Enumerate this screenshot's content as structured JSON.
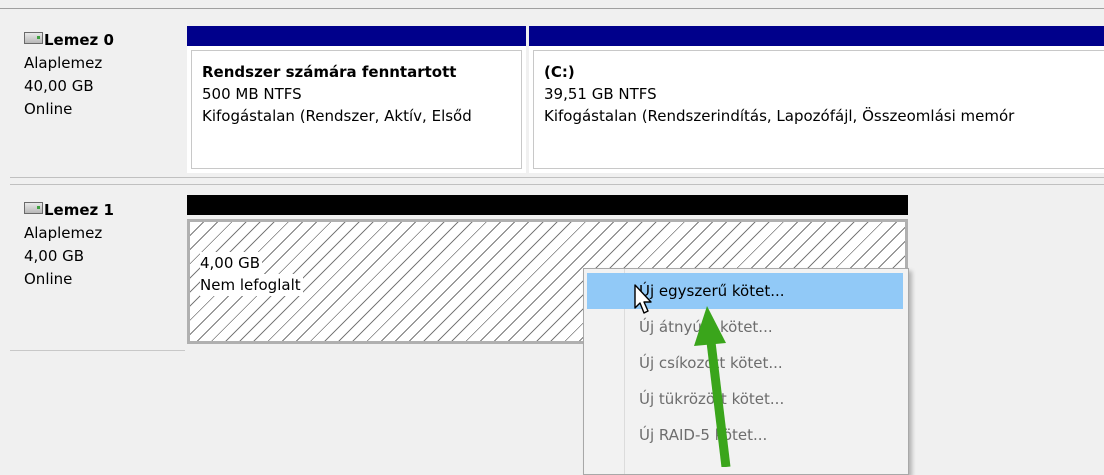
{
  "disks": [
    {
      "title": "Lemez 0",
      "type": "Alaplemez",
      "size": "40,00 GB",
      "status": "Online",
      "icon": "disk-icon",
      "partitions": [
        {
          "name": "Rendszer számára fenntartott",
          "size_fs": "500 MB NTFS",
          "status": "Kifogástalan (Rendszer, Aktív, Elsőd",
          "bar_color": "#00008b"
        },
        {
          "name": "(C:)",
          "size_fs": "39,51 GB NTFS",
          "status": "Kifogástalan (Rendszerindítás, Lapozófájl, Összeomlási memór",
          "bar_color": "#00008b"
        }
      ]
    },
    {
      "title": "Lemez 1",
      "type": "Alaplemez",
      "size": "4,00 GB",
      "status": "Online",
      "icon": "disk-icon",
      "partitions": [
        {
          "size": "4,00 GB",
          "label": "Nem lefoglalt",
          "bar_color": "#000000"
        }
      ]
    }
  ],
  "context_menu": {
    "items": [
      {
        "label": "Új egyszerű kötet...",
        "enabled": true,
        "highlighted": true
      },
      {
        "label": "Új átnyúló kötet...",
        "enabled": false
      },
      {
        "label": "Új csíkozott kötet...",
        "enabled": false
      },
      {
        "label": "Új tükrözött kötet...",
        "enabled": false
      },
      {
        "label": "Új RAID-5 kötet...",
        "enabled": false
      }
    ]
  },
  "colors": {
    "highlight": "#91c9f7",
    "annotation_arrow": "#3aa51b",
    "volume_bar": "#00008b",
    "unallocated_bar": "#000000"
  }
}
